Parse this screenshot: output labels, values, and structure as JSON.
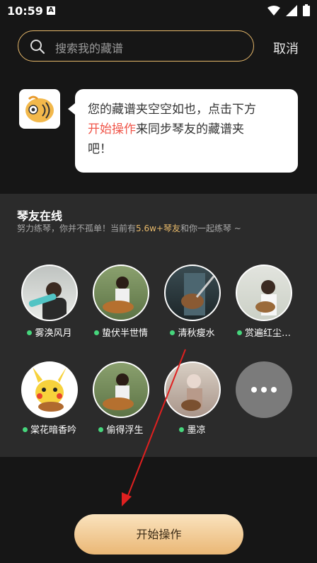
{
  "status": {
    "time": "10:59",
    "notification_letter": "A"
  },
  "search": {
    "placeholder": "搜索我的藏谱",
    "cancel_label": "取消"
  },
  "bubble": {
    "line1": "您的藏谱夹空空如也，点击下方",
    "highlight": "开始操作",
    "line2_rest": "来同步琴友的藏谱夹",
    "line3": "吧！"
  },
  "online": {
    "title": "琴友在线",
    "subtitle_prefix": "努力练琴，你并不孤单！当前有",
    "subtitle_highlight": "5.6w+琴友",
    "subtitle_suffix": "和你一起练琴 ~",
    "users": [
      {
        "name": "雾涣风月"
      },
      {
        "name": "蛰伏半世情"
      },
      {
        "name": "清秋瘦水"
      },
      {
        "name": "赏遍红尘…"
      },
      {
        "name": "棠花暗香吟"
      },
      {
        "name": "偷得浮生"
      },
      {
        "name": "墨凉"
      }
    ]
  },
  "action": {
    "start_label": "开始操作"
  },
  "colors": {
    "accent": "#E6B86A",
    "online_dot": "#46D67C",
    "highlight": "#F0564A"
  }
}
